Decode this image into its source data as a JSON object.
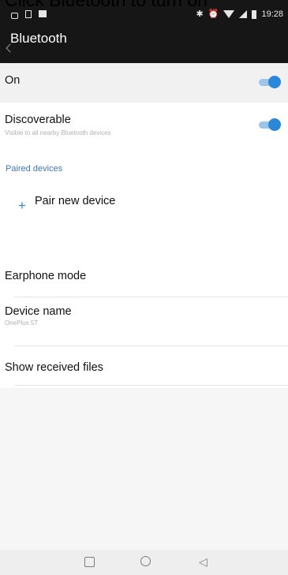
{
  "caption": "Click Bluetooth to turn on",
  "status_bar": {
    "time": "19:28",
    "icons": [
      "lock-icon",
      "sim-card-icon",
      "image-icon",
      "bluetooth-icon",
      "alarm-icon",
      "wifi-icon",
      "signal-icon",
      "battery-icon"
    ]
  },
  "app_bar": {
    "title": "Bluetooth",
    "back_icon": "back-arrow-icon"
  },
  "settings": {
    "on": {
      "label": "On",
      "toggle_on": true
    },
    "discoverable": {
      "label": "Discoverable",
      "subtitle": "Visible to all nearby Bluetooth devices",
      "toggle_on": true
    },
    "paired_header": "Paired devices",
    "pair_new": {
      "label": "Pair new device",
      "icon": "plus-icon"
    },
    "earphone_mode": {
      "label": "Earphone mode"
    },
    "device_name": {
      "label": "Device name",
      "subtitle": "OnePlus 5T"
    },
    "show_received": {
      "label": "Show received files"
    }
  },
  "colors": {
    "accent": "#2d87d8",
    "header": "#3d77b6",
    "appbar": "#161616"
  },
  "nav_bar": [
    "recents-icon",
    "home-icon",
    "back-icon"
  ]
}
